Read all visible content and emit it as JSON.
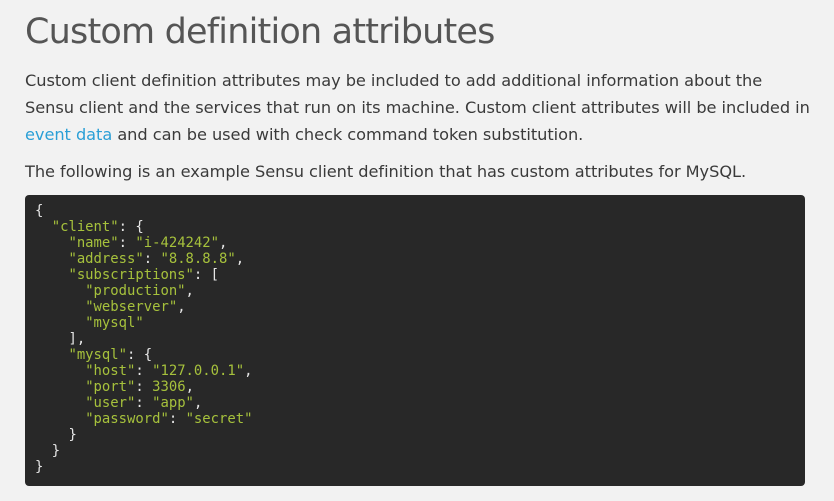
{
  "heading": "Custom definition attributes",
  "paragraph1": {
    "text_before": "Custom client definition attributes may be included to add additional information about the Sensu client and the services that run on its machine. Custom client attributes will be included in ",
    "link_text": "event data",
    "text_after": " and can be used with check command token substitution."
  },
  "paragraph2": "The following is an example Sensu client definition that has custom attributes for MySQL.",
  "code": {
    "lines": [
      {
        "indent": "",
        "tokens": [
          [
            "p",
            "{"
          ]
        ]
      },
      {
        "indent": "  ",
        "tokens": [
          [
            "k",
            "\"client\""
          ],
          [
            "p",
            ": {"
          ]
        ]
      },
      {
        "indent": "    ",
        "tokens": [
          [
            "k",
            "\"name\""
          ],
          [
            "p",
            ": "
          ],
          [
            "s",
            "\"i-424242\""
          ],
          [
            "p",
            ","
          ]
        ]
      },
      {
        "indent": "    ",
        "tokens": [
          [
            "k",
            "\"address\""
          ],
          [
            "p",
            ": "
          ],
          [
            "s",
            "\"8.8.8.8\""
          ],
          [
            "p",
            ","
          ]
        ]
      },
      {
        "indent": "    ",
        "tokens": [
          [
            "k",
            "\"subscriptions\""
          ],
          [
            "p",
            ": ["
          ]
        ]
      },
      {
        "indent": "      ",
        "tokens": [
          [
            "s",
            "\"production\""
          ],
          [
            "p",
            ","
          ]
        ]
      },
      {
        "indent": "      ",
        "tokens": [
          [
            "s",
            "\"webserver\""
          ],
          [
            "p",
            ","
          ]
        ]
      },
      {
        "indent": "      ",
        "tokens": [
          [
            "s",
            "\"mysql\""
          ]
        ]
      },
      {
        "indent": "    ",
        "tokens": [
          [
            "p",
            "],"
          ]
        ]
      },
      {
        "indent": "    ",
        "tokens": [
          [
            "k",
            "\"mysql\""
          ],
          [
            "p",
            ": {"
          ]
        ]
      },
      {
        "indent": "      ",
        "tokens": [
          [
            "k",
            "\"host\""
          ],
          [
            "p",
            ": "
          ],
          [
            "s",
            "\"127.0.0.1\""
          ],
          [
            "p",
            ","
          ]
        ]
      },
      {
        "indent": "      ",
        "tokens": [
          [
            "k",
            "\"port\""
          ],
          [
            "p",
            ": "
          ],
          [
            "n",
            "3306"
          ],
          [
            "p",
            ","
          ]
        ]
      },
      {
        "indent": "      ",
        "tokens": [
          [
            "k",
            "\"user\""
          ],
          [
            "p",
            ": "
          ],
          [
            "s",
            "\"app\""
          ],
          [
            "p",
            ","
          ]
        ]
      },
      {
        "indent": "      ",
        "tokens": [
          [
            "k",
            "\"password\""
          ],
          [
            "p",
            ": "
          ],
          [
            "s",
            "\"secret\""
          ]
        ]
      },
      {
        "indent": "    ",
        "tokens": [
          [
            "p",
            "}"
          ]
        ]
      },
      {
        "indent": "  ",
        "tokens": [
          [
            "p",
            "}"
          ]
        ]
      },
      {
        "indent": "",
        "tokens": [
          [
            "p",
            "}"
          ]
        ]
      }
    ]
  }
}
